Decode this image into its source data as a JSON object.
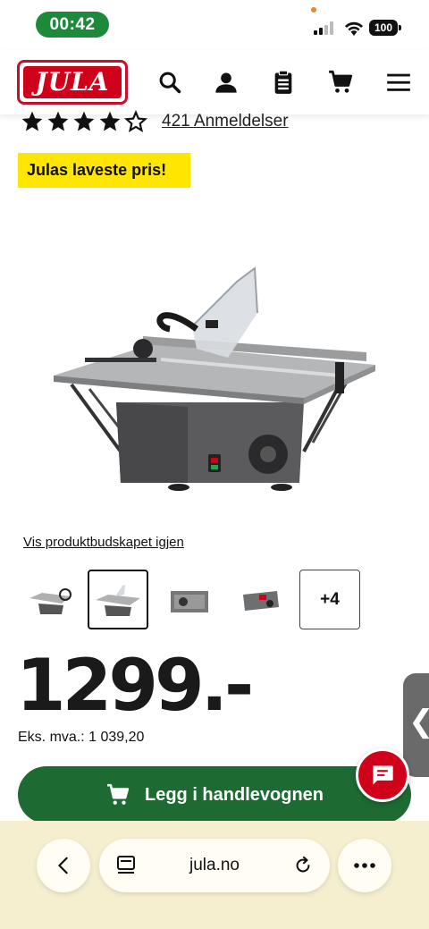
{
  "status": {
    "time": "00:42",
    "battery": "100"
  },
  "header": {
    "logo_text": "JULA",
    "icons": [
      "search-icon",
      "account-icon",
      "shopping-list-icon",
      "cart-icon",
      "menu-icon"
    ]
  },
  "product": {
    "rating": 4.5,
    "reviews": "421 Anmeldelser",
    "badge": "Julas laveste pris!",
    "offer_link": "Vis produktbudskapet igjen",
    "thumbnails_more": "+4",
    "price": "1299.-",
    "ex_vat": "Eks. mva.: 1 039,20",
    "add_to_cart": "Legg i handlevognen"
  },
  "side_tab": {
    "arrow": "❮"
  },
  "browser": {
    "url": "jula.no"
  },
  "colors": {
    "brand_red": "#d0021b",
    "cart_green": "#1d6b33",
    "badge_yellow": "#ffe600",
    "time_green": "#1d8a3b",
    "browser_bar": "#f6efcf"
  }
}
